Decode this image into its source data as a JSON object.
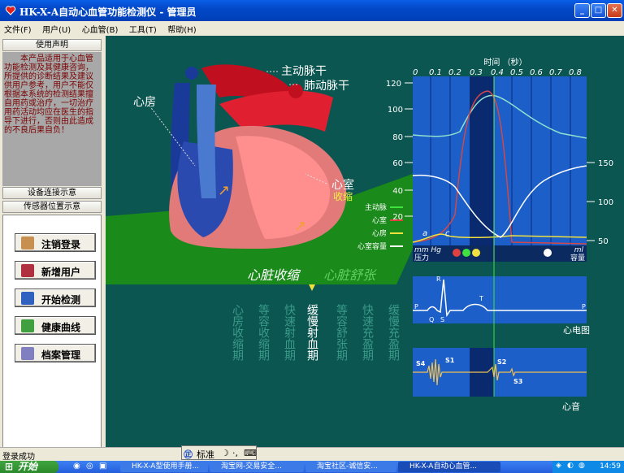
{
  "window": {
    "title": "HK-X-A自动心血管功能检测仪 - 管理员",
    "controls": [
      "minimize-icon",
      "maximize-icon",
      "close-icon"
    ]
  },
  "menu": [
    "文件(F)",
    "用户(U)",
    "心血管(B)",
    "工具(T)",
    "帮助(H)"
  ],
  "left": {
    "instructions_header": "使用声明",
    "notice": "本产品适用于心血管功能检测及其健康咨询，所提供的诊断结果及建议供用户参考，用户不能仅根据本系统的检测结果擅自用药或治疗，一切治疗用药活动均应在医生的指导下进行，否则由此造成的不良后果自负！",
    "device_connect": "设备连接示意",
    "sensor_position": "传感器位置示意",
    "buttons": [
      {
        "label": "注销登录",
        "icon": "logout-user-icon",
        "color": "#c89050"
      },
      {
        "label": "新增用户",
        "icon": "add-user-icon",
        "color": "#b03040"
      },
      {
        "label": "开始检测",
        "icon": "monitor-icon",
        "color": "#3060c0"
      },
      {
        "label": "健康曲线",
        "icon": "chart-icon",
        "color": "#40a040"
      },
      {
        "label": "档案管理",
        "icon": "archive-icon",
        "color": "#8080c0"
      }
    ]
  },
  "heart": {
    "aorta": "主动脉干",
    "pulmonary": "肺动脉干",
    "atrium": "心房",
    "ventricle": "心室",
    "ventricle_state": "收缩"
  },
  "chart": {
    "time_label": "时间 （秒）",
    "time_ticks": [
      "0",
      "0.1",
      "0.2",
      "0.3",
      "0.4",
      "0.5",
      "0.6",
      "0.7",
      "0.8"
    ],
    "left_ticks": [
      "120",
      "100",
      "80",
      "60",
      "40",
      "20"
    ],
    "right_ticks": [
      "150",
      "100",
      "50"
    ],
    "left_unit": "mm Hg",
    "left_label": "压力",
    "right_unit": "ml",
    "right_label": "容量",
    "markers": [
      "a",
      "c"
    ],
    "colors": {
      "aortic": "#40e040",
      "ventricle": "#e04040",
      "atrium": "#f0e040",
      "volume": "#ffffff",
      "panel": "#1c5fc8"
    },
    "legend": [
      "主动脉",
      "心室",
      "心房",
      "心室容量"
    ]
  },
  "phases": {
    "systole": "心脏收缩",
    "diastole": "心脏舒张",
    "list": [
      "心房收缩期",
      "等容收缩期",
      "快速射血期",
      "缓慢射血期",
      "等容舒张期",
      "快速充盈期",
      "缓慢充盈期"
    ],
    "active_index": 3
  },
  "ecg": {
    "title": "心电图",
    "labels": [
      "P",
      "R",
      "Q",
      "S",
      "T",
      "P"
    ]
  },
  "pcg": {
    "title": "心音",
    "labels": [
      "S4",
      "S1",
      "S2",
      "S3"
    ]
  },
  "status": {
    "text": "登录成功",
    "ime": "标准"
  },
  "taskbar": {
    "start": "开始",
    "tasks": [
      "HK-X-A型使用手册...",
      "淘宝网-交易安全...",
      "淘宝社区-诚信安...",
      "HK-X-A自动心血管..."
    ],
    "clock": "14:59"
  }
}
